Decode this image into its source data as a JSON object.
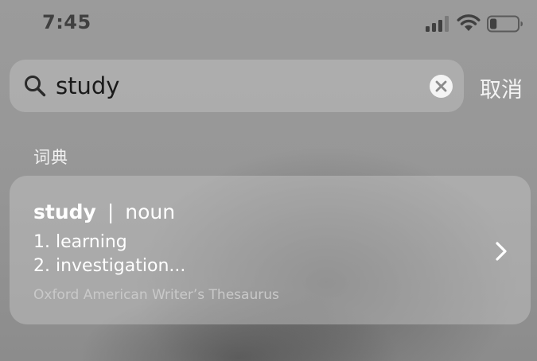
{
  "status_bar": {
    "time": "7:45",
    "icons": [
      "signal-icon",
      "wifi-icon",
      "battery-icon"
    ],
    "battery_level": 0.25
  },
  "search": {
    "query": "study",
    "icon": "search-icon",
    "clear_icon": "clear-icon",
    "cancel_label": "取消"
  },
  "section": {
    "title": "词典"
  },
  "dictionary_entry": {
    "word": "study",
    "separator": "|",
    "part_of_speech": "noun",
    "definitions": [
      "1. learning",
      "2. investigation..."
    ],
    "source": "Oxford American Writer’s Thesaurus",
    "chevron_icon": "chevron-right-icon"
  },
  "colors": {
    "background": "#979797",
    "card": "#b4b4b4",
    "text_primary": "#ffffff",
    "text_secondary": "#c9c9c9"
  }
}
